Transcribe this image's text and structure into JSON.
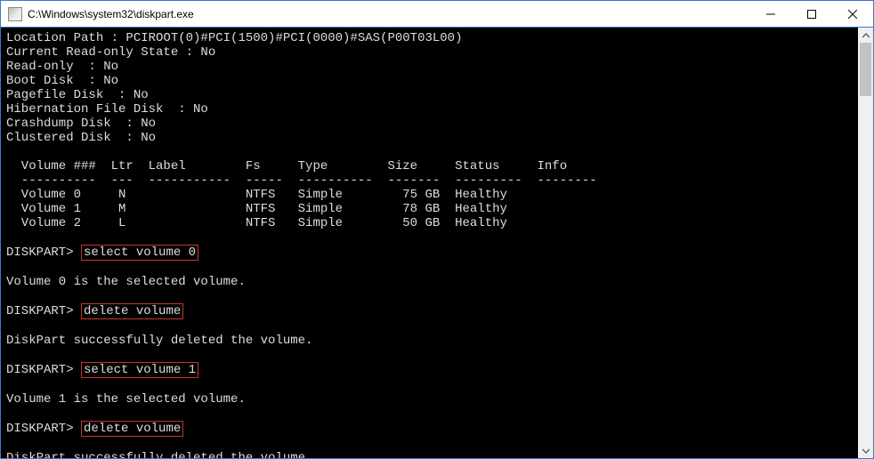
{
  "window": {
    "title": "C:\\Windows\\system32\\diskpart.exe"
  },
  "info": {
    "location_path": "Location Path : PCIROOT(0)#PCI(1500)#PCI(0000)#SAS(P00T03L00)",
    "readonly_state": "Current Read-only State : No",
    "readonly": "Read-only  : No",
    "boot": "Boot Disk  : No",
    "pagefile": "Pagefile Disk  : No",
    "hibernation": "Hibernation File Disk  : No",
    "crashdump": "Crashdump Disk  : No",
    "clustered": "Clustered Disk  : No"
  },
  "table": {
    "header": "  Volume ###  Ltr  Label        Fs     Type        Size     Status     Info",
    "divider": "  ----------  ---  -----------  -----  ----------  -------  ---------  --------",
    "rows": [
      "  Volume 0     N                NTFS   Simple        75 GB  Healthy",
      "  Volume 1     M                NTFS   Simple        78 GB  Healthy",
      "  Volume 2     L                NTFS   Simple        50 GB  Healthy"
    ]
  },
  "prompt": "DISKPART>",
  "cmds": {
    "c1": "select volume 0",
    "r1": "Volume 0 is the selected volume.",
    "c2": "delete volume",
    "r2": "DiskPart successfully deleted the volume.",
    "c3": "select volume 1",
    "r3": "Volume 1 is the selected volume.",
    "c4": "delete volume",
    "r4": "DiskPart successfully deleted the volume."
  }
}
